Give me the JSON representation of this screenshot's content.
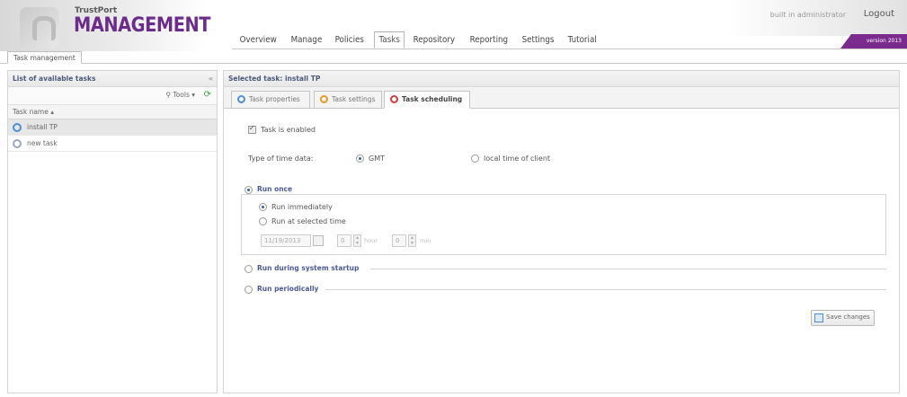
{
  "header": {
    "brand_small": "TrustPort",
    "brand_big": "MANAGEMENT",
    "user_info": "built in administrator",
    "logout": "Logout",
    "version": "version 2013"
  },
  "nav": {
    "items": [
      "Overview",
      "Manage",
      "Policies",
      "Tasks",
      "Repository",
      "Reporting",
      "Settings",
      "Tutorial"
    ],
    "active": "Tasks"
  },
  "top_tab": "Task management",
  "left_panel": {
    "title": "List of available tasks",
    "collapse": "«",
    "tools_label": "Tools ▾",
    "column_header": "Task name ▴",
    "tasks": [
      "install TP",
      "new task"
    ]
  },
  "right_panel": {
    "title": "Selected task: install TP",
    "tabs": [
      "Task properties",
      "Task settings",
      "Task scheduling"
    ],
    "active_tab": "Task scheduling",
    "task_enabled_label": "Task is enabled",
    "time_type_label": "Type of time data:",
    "gmt_label": "GMT",
    "local_time_label": "local time of client",
    "run_once_label": "Run once",
    "run_immediately_label": "Run immediately",
    "run_selected_time_label": "Run at selected time",
    "date_value": "11/19/2013",
    "hour_value": "0",
    "hour_unit": "hour",
    "min_value": "0",
    "min_unit": "min",
    "run_startup_label": "Run during system startup",
    "run_periodically_label": "Run periodically",
    "save_label": "Save changes"
  },
  "colors": {
    "brand": "#6b2c8a",
    "section": "#4a5a98",
    "version_bar": "#7b2a8e"
  }
}
